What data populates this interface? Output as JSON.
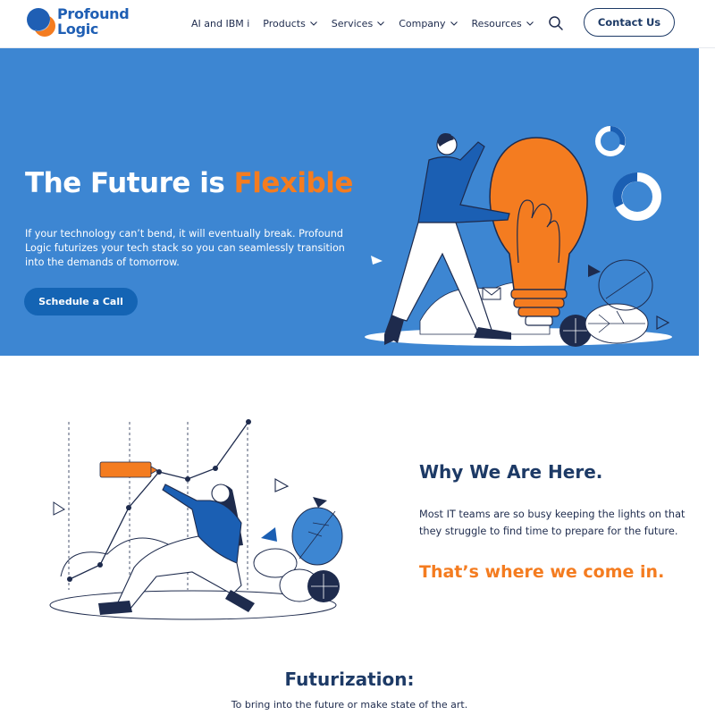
{
  "brand": {
    "line1": "Profound",
    "line2": "Logic",
    "colors": {
      "blue": "#1f5fb4",
      "orange": "#f47c20",
      "navy": "#1d3a66",
      "hero_bg": "#3d86d2"
    }
  },
  "nav": {
    "items": [
      {
        "label": "AI and IBM i",
        "has_dropdown": false
      },
      {
        "label": "Products",
        "has_dropdown": true
      },
      {
        "label": "Services",
        "has_dropdown": true
      },
      {
        "label": "Company",
        "has_dropdown": true
      },
      {
        "label": "Resources",
        "has_dropdown": true
      }
    ],
    "search_icon": "search-icon",
    "contact_label": "Contact Us"
  },
  "hero": {
    "title_prefix": "The Future is ",
    "title_accent": "Flexible",
    "description": "If your technology can’t bend, it will eventually break. Profound Logic futurizes your tech stack so you can seamlessly transition into the demands of tomorrow.",
    "cta_label": "Schedule a Call",
    "illustration": "person-pushing-lightbulb-illustration"
  },
  "why": {
    "illustration": "person-drawing-growth-chart-illustration",
    "title": "Why We Are Here.",
    "text": "Most IT teams are so busy keeping the lights on that they struggle to find time to prepare for the future.",
    "accent": "That’s where we come in."
  },
  "futurization": {
    "title": "Futurization:",
    "definition": "To bring into the future or make state of the art."
  }
}
